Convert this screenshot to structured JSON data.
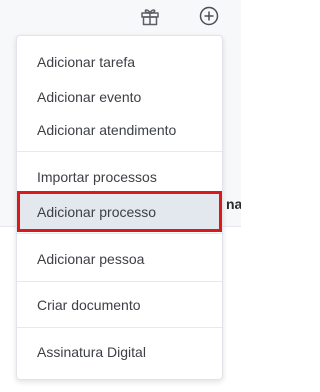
{
  "background": {
    "clipped_text": "na"
  },
  "header": {
    "icons": [
      "gift-icon",
      "plus-circle-icon"
    ]
  },
  "menu": {
    "items": [
      {
        "label": "Adicionar tarefa"
      },
      {
        "label": "Adicionar evento"
      },
      {
        "label": "Adicionar atendimento"
      },
      {
        "label": "Importar processos"
      },
      {
        "label": "Adicionar processo",
        "selected": true
      },
      {
        "label": "Adicionar pessoa"
      },
      {
        "label": "Criar documento"
      },
      {
        "label": "Assinatura Digital"
      }
    ]
  },
  "colors": {
    "highlight_border": "#d81a1a",
    "selected_bg": "#e3e7ee",
    "text": "#3c3f44"
  }
}
